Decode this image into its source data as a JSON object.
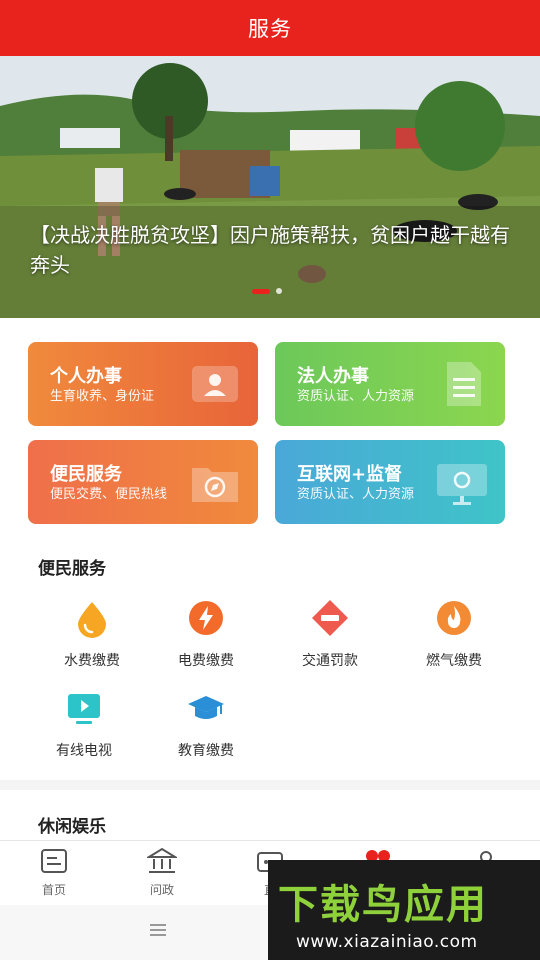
{
  "header": {
    "title": "服务"
  },
  "banner": {
    "caption": "【决战决胜脱贫攻坚】因户施策帮扶，贫困户越干越有奔头",
    "slide_count": 2,
    "active_slide": 1
  },
  "cards": [
    {
      "title": "个人办事",
      "subtitle": "生育收养、身份证",
      "icon": "id-card-icon",
      "color": "#ec6f3b"
    },
    {
      "title": "法人办事",
      "subtitle": "资质认证、人力资源",
      "icon": "document-icon",
      "color": "#7acd55"
    },
    {
      "title": "便民服务",
      "subtitle": "便民交费、便民热线",
      "icon": "compass-folder-icon",
      "color": "#ef7b44"
    },
    {
      "title": "互联网+监督",
      "subtitle": "资质认证、人力资源",
      "icon": "monitor-icon",
      "color": "#45b6d0"
    }
  ],
  "convenience": {
    "title": "便民服务",
    "items": [
      {
        "label": "水费缴费",
        "icon": "water-drop-icon",
        "color": "#f6a623"
      },
      {
        "label": "电费缴费",
        "icon": "lightning-icon",
        "color": "#f26b2b"
      },
      {
        "label": "交通罚款",
        "icon": "no-entry-icon",
        "color": "#ee5a4e"
      },
      {
        "label": "燃气缴费",
        "icon": "flame-icon",
        "color": "#f38a34"
      },
      {
        "label": "有线电视",
        "icon": "tv-icon",
        "color": "#2cc3c9"
      },
      {
        "label": "教育缴费",
        "icon": "graduation-cap-icon",
        "color": "#2a8fd6"
      }
    ]
  },
  "leisure": {
    "title": "休闲娱乐"
  },
  "tabbar": {
    "items": [
      {
        "label": "首页",
        "icon": "home-doc-icon"
      },
      {
        "label": "问政",
        "icon": "government-building-icon"
      },
      {
        "label": "直",
        "icon": "video-icon"
      },
      {
        "label": "",
        "icon": "service-dots-icon",
        "active": true
      },
      {
        "label": "",
        "icon": "user-icon"
      }
    ]
  },
  "watermark": {
    "brand": "下载鸟应用",
    "url": "www.xiazainiao.com"
  },
  "colors": {
    "accent": "#e8231e"
  }
}
